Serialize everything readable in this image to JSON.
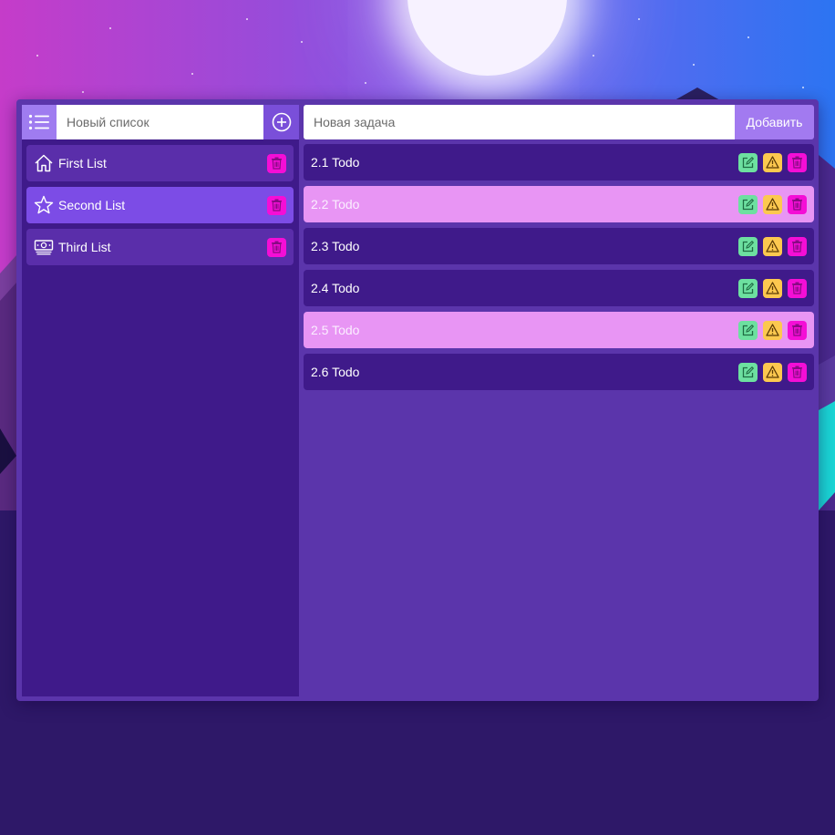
{
  "colors": {
    "sidebar_bg": "#3f1a8a",
    "main_bg": "#5b35ab",
    "list_item": "#5a2eaa",
    "list_item_active": "#7c4ce6",
    "task_item": "#3f1a8a",
    "task_highlight": "#e895f4",
    "delete": "#f40ed6",
    "edit": "#6de0a0",
    "warning": "#fcc84f",
    "add_button": "#a27af0"
  },
  "sidebar": {
    "menu_icon": "list-icon",
    "new_list_placeholder": "Новый список",
    "add_icon": "plus-circle-icon",
    "lists": [
      {
        "label": "First List",
        "icon": "home-icon",
        "active": false
      },
      {
        "label": "Second List",
        "icon": "star-icon",
        "active": true
      },
      {
        "label": "Third List",
        "icon": "money-icon",
        "active": false
      }
    ]
  },
  "main": {
    "new_task_placeholder": "Новая задача",
    "add_label": "Добавить",
    "tasks": [
      {
        "label": "2.1 Todo",
        "highlight": false
      },
      {
        "label": "2.2 Todo",
        "highlight": true
      },
      {
        "label": "2.3 Todo",
        "highlight": false
      },
      {
        "label": "2.4 Todo",
        "highlight": false
      },
      {
        "label": "2.5 Todo",
        "highlight": true
      },
      {
        "label": "2.6 Todo",
        "highlight": false
      }
    ]
  }
}
